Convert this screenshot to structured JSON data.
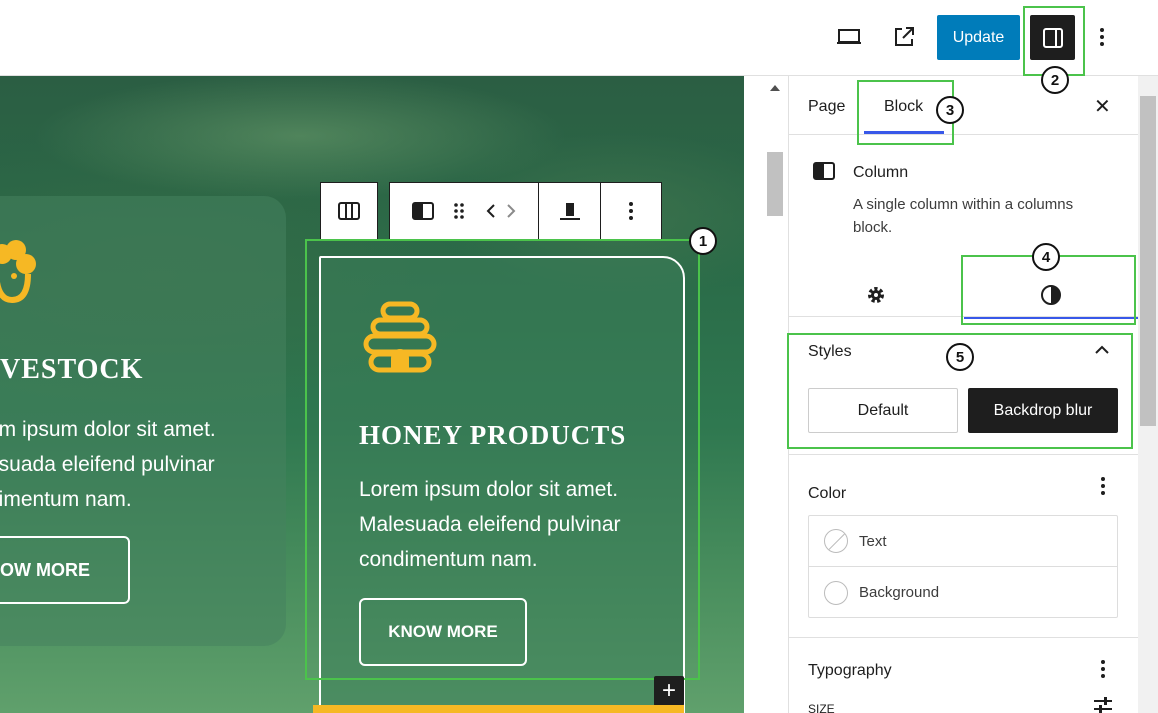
{
  "topbar": {
    "update_label": "Update",
    "icons": [
      "desktop-preview-icon",
      "external-link-icon",
      "sidebar-toggle-icon",
      "more-options-icon"
    ]
  },
  "canvas": {
    "left_card": {
      "title": "VESTOCK",
      "text": "em ipsum dolor sit amet. esuada eleifend pulvinar dimentum nam.",
      "line1": "em ipsum dolor sit amet.",
      "line2": "esuada eleifend pulvinar",
      "line3": "dimentum nam.",
      "button": "KNOW MORE"
    },
    "main_card": {
      "title": "HONEY PRODUCTS",
      "text": "Lorem ipsum dolor sit amet. Malesuada eleifend pulvinar condimentum nam.",
      "button": "KNOW MORE"
    },
    "add_label": "+"
  },
  "panel": {
    "tabs": [
      "Page",
      "Block"
    ],
    "close_label": "✕",
    "block": {
      "title": "Column",
      "description": "A single column within a columns block."
    },
    "styles": {
      "title": "Styles",
      "options": [
        "Default",
        "Backdrop blur"
      ],
      "selected": "Backdrop blur"
    },
    "color": {
      "title": "Color",
      "items": [
        "Text",
        "Background"
      ]
    },
    "typography": {
      "title": "Typography",
      "size_label": "SIZE"
    }
  },
  "annotations": [
    "1",
    "2",
    "3",
    "4",
    "5"
  ],
  "colors": {
    "accent": "#007cba",
    "highlight": "#4bc34b",
    "tab_underline": "#3858e9",
    "honey_yellow": "#f6b824"
  }
}
